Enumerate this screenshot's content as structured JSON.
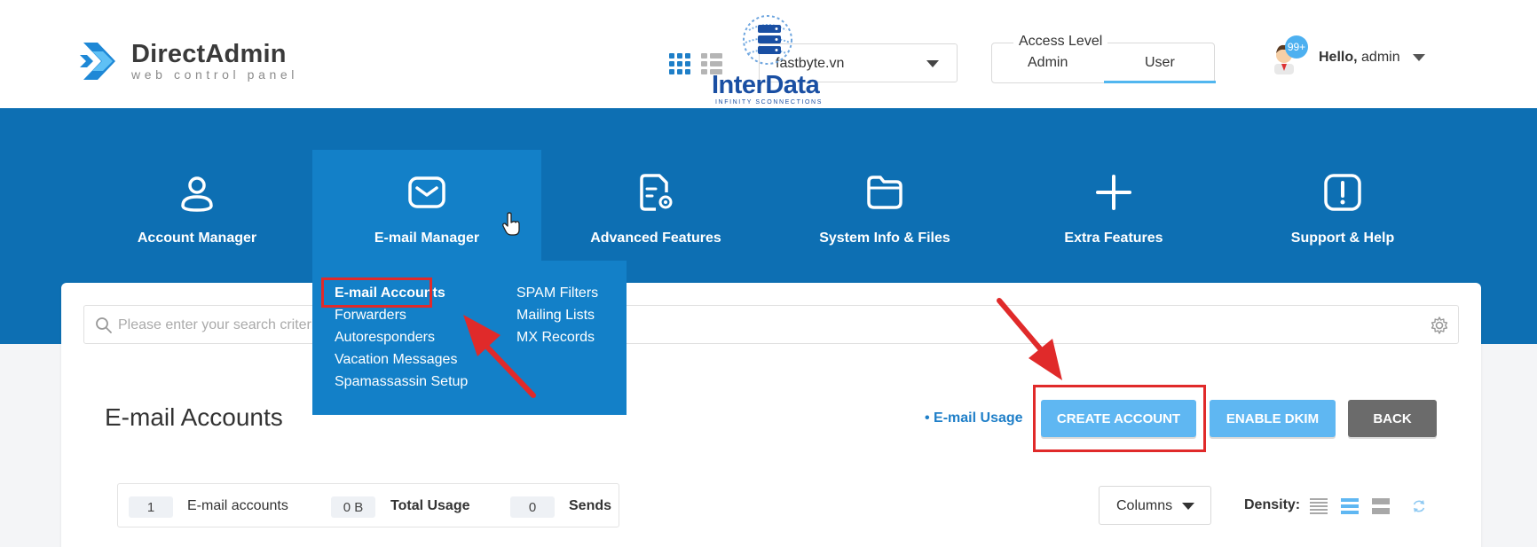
{
  "header": {
    "logo": {
      "name": "DirectAdmin",
      "tagline": "web control panel"
    },
    "domain_select": {
      "value": "fastbyte.vn"
    },
    "watermark": {
      "text": "InterData",
      "subtext": "INFINITY SCONNECTIONS"
    },
    "access_level": {
      "legend": "Access Level",
      "options": [
        "Admin",
        "User"
      ],
      "selected": "User"
    },
    "user": {
      "badge": "99+",
      "hello": "Hello,",
      "name": "admin"
    }
  },
  "nav": {
    "items": [
      {
        "label": "Account Manager",
        "icon": "user-icon"
      },
      {
        "label": "E-mail Manager",
        "icon": "envelope-icon",
        "active": true
      },
      {
        "label": "Advanced Features",
        "icon": "document-gear-icon"
      },
      {
        "label": "System Info & Files",
        "icon": "folder-icon"
      },
      {
        "label": "Extra Features",
        "icon": "plus-icon"
      },
      {
        "label": "Support & Help",
        "icon": "alert-icon"
      }
    ]
  },
  "submenu": {
    "col1": [
      "E-mail Accounts",
      "Forwarders",
      "Autoresponders",
      "Vacation Messages",
      "Spamassassin Setup"
    ],
    "col2": [
      "SPAM Filters",
      "Mailing Lists",
      "MX Records"
    ],
    "active": "E-mail Accounts"
  },
  "search": {
    "placeholder": "Please enter your search criteria"
  },
  "page": {
    "title": "E-mail Accounts",
    "usage_link": "• E-mail Usage",
    "buttons": {
      "create": "CREATE ACCOUNT",
      "dkim": "ENABLE DKIM",
      "back": "BACK"
    }
  },
  "stats": [
    {
      "value": "1",
      "label": "E-mail accounts"
    },
    {
      "value": "0 B",
      "label": "Total Usage"
    },
    {
      "value": "0",
      "label": "Sends"
    }
  ],
  "table_controls": {
    "columns_label": "Columns",
    "density_label": "Density:",
    "density_selected": "medium"
  },
  "colors": {
    "nav_band": "#0d6fb3",
    "nav_active": "#1380c8",
    "primary_button": "#5fb7f2",
    "back_button": "#6b6b6b",
    "link": "#1f7fc8",
    "annotation": "#e02a2a"
  }
}
